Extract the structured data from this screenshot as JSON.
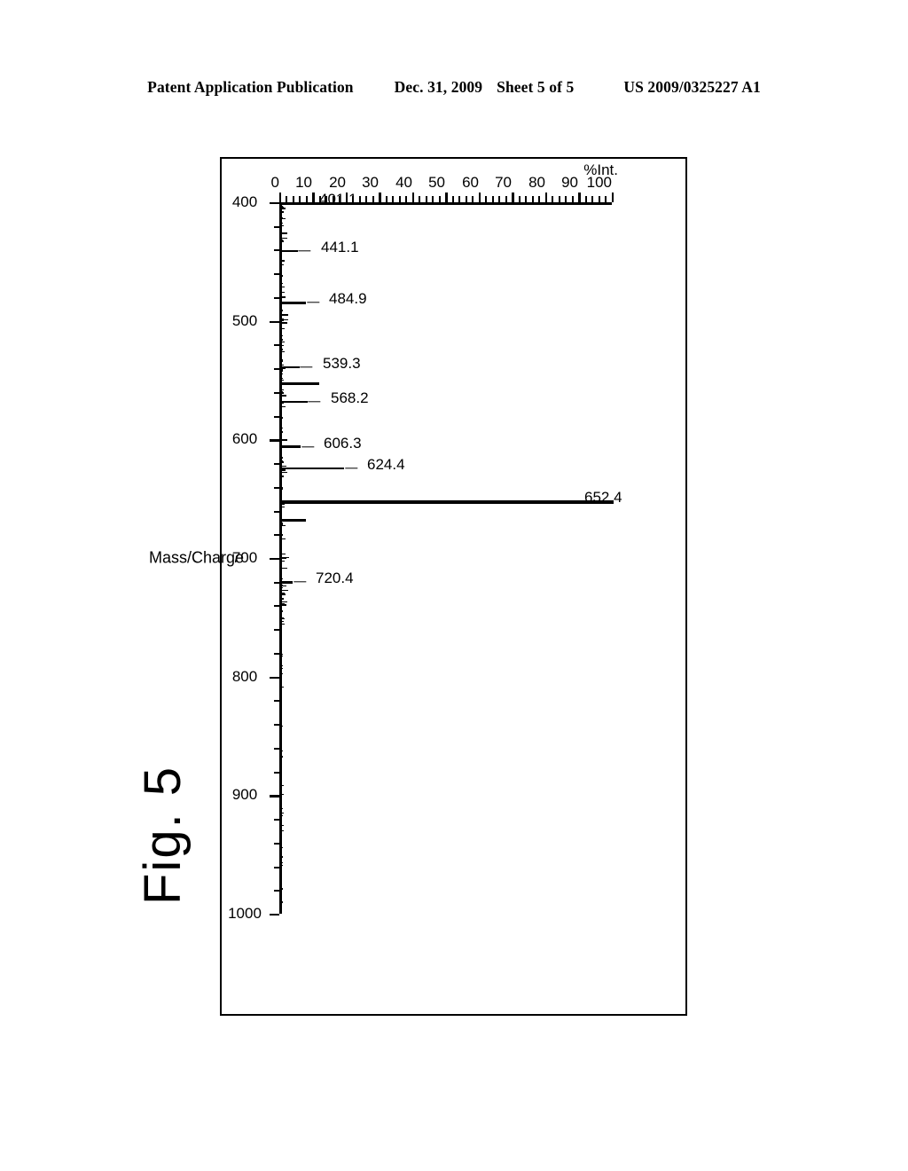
{
  "header": {
    "publication": "Patent Application Publication",
    "date": "Dec. 31, 2009",
    "sheet": "Sheet 5 of 5",
    "patent_number": "US 2009/0325227 A1"
  },
  "figure": {
    "caption": "Fig. 5"
  },
  "chart_data": {
    "type": "bar",
    "title": "",
    "subtitle": "",
    "xlabel": "Mass/Charge",
    "ylabel": "%Int.",
    "xlim": [
      400,
      1000
    ],
    "ylim": [
      0,
      100
    ],
    "grid": false,
    "legend": null,
    "orientation": "rotated-90-ccw",
    "x_major_ticks": [
      400,
      500,
      600,
      700,
      800,
      900,
      1000
    ],
    "x_tick_labels": [
      "400",
      "500",
      "600",
      "700",
      "800",
      "900",
      "1000"
    ],
    "x_minor_tick_step": 20,
    "y_major_ticks": [
      0,
      10,
      20,
      30,
      40,
      50,
      60,
      70,
      80,
      90,
      100
    ],
    "y_tick_labels": [
      "100",
      "90",
      "80",
      "70",
      "60",
      "50",
      "40",
      "30",
      "20",
      "10",
      "0"
    ],
    "y_minor_tick_step": 2,
    "x": [
      401.1,
      441.1,
      484.9,
      539.3,
      553.0,
      568.2,
      606.3,
      624.4,
      652.4,
      668.0,
      720.4
    ],
    "values": [
      4.5,
      5.0,
      7.5,
      5.5,
      11.5,
      8.0,
      6.0,
      19.0,
      100.0,
      7.5,
      3.5
    ],
    "annotations": [
      {
        "label": "401.1",
        "x": 401.1,
        "y": 4.5
      },
      {
        "label": "441.1",
        "x": 441.1,
        "y": 5.0
      },
      {
        "label": "484.9",
        "x": 484.9,
        "y": 7.5
      },
      {
        "label": "539.3",
        "x": 539.3,
        "y": 5.5
      },
      {
        "label": "568.2",
        "x": 568.2,
        "y": 8.0
      },
      {
        "label": "606.3",
        "x": 606.3,
        "y": 6.0
      },
      {
        "label": "624.4",
        "x": 624.4,
        "y": 19.0
      },
      {
        "label": "652.4",
        "x": 652.4,
        "y": 100.0
      },
      {
        "label": "720.4",
        "x": 720.4,
        "y": 3.5
      }
    ],
    "base_peak": "652.4"
  }
}
